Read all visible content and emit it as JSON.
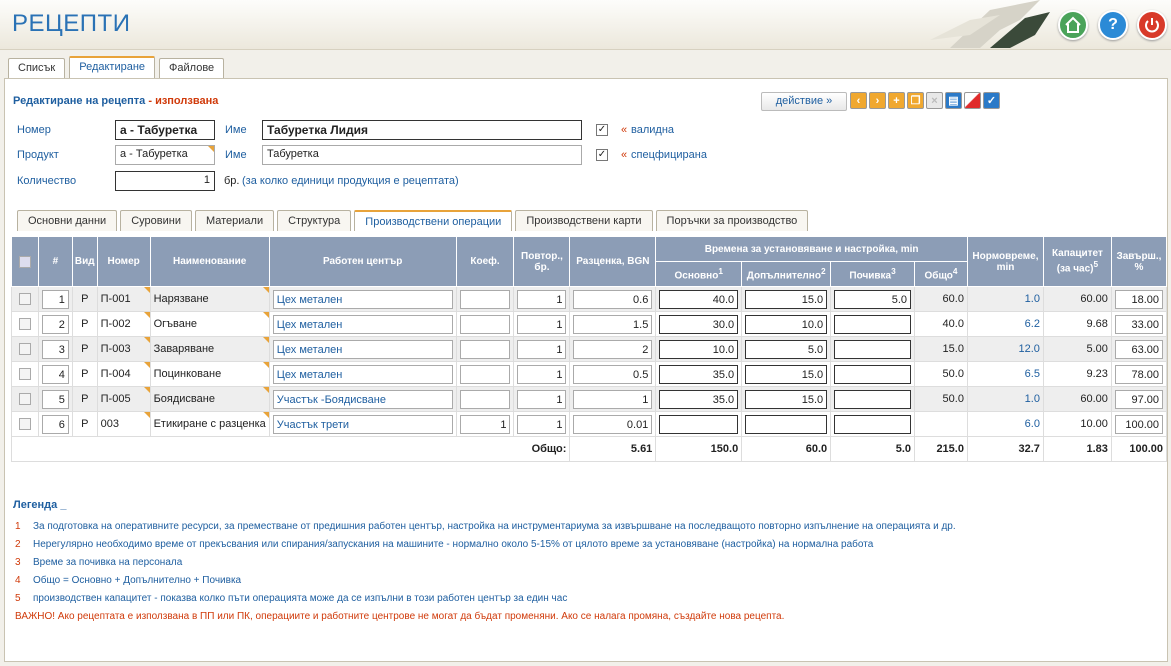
{
  "app": {
    "title": "РЕЦЕПТИ"
  },
  "header_buttons": {
    "home": "home-icon",
    "help": "?",
    "power": "power-icon"
  },
  "top_tabs": [
    "Списък",
    "Редактиране",
    "Файлове"
  ],
  "edit": {
    "title": "Редактиране на рецепта",
    "sep": " - ",
    "status": "използвана",
    "action_label": "действие  »"
  },
  "form": {
    "number_label": "Номер",
    "number_value": "а - Табуретка",
    "name_label": "Име",
    "name_value": "Табуретка Лидия",
    "valid_label": "« валидна",
    "product_label": "Продукт",
    "product_value": "а - Табуретка",
    "product_name_label": "Име",
    "product_name_value": "Табуретка",
    "specified_label": "« спецфицирана",
    "qty_label": "Количество",
    "qty_value": "1",
    "qty_unit": "бр.",
    "qty_hint": "(за колко единици продукция е рецептата)"
  },
  "sub_tabs": [
    "Основни данни",
    "Суровини",
    "Материали",
    "Структура",
    "Производствени операции",
    "Производствени карти",
    "Поръчки за производство"
  ],
  "table": {
    "headers": {
      "num": "#",
      "kind": "Вид",
      "code": "Номер",
      "name": "Наименование",
      "wc": "Работен център",
      "coef": "Коеф.",
      "rep": "Повтор., бр.",
      "cost": "Разценка, BGN",
      "times": "Времена за установяване и настройка, min",
      "base": "Основно",
      "extra": "Допълнително",
      "rest": "Почивка",
      "total": "Общо",
      "norm": "Нормовреме, min",
      "cap": "Капацитет (за час)",
      "done": "Завърш., %"
    },
    "rows": [
      {
        "n": "1",
        "kind": "Р",
        "code": "П-001",
        "name": "Нарязване",
        "wc": "Цех метален",
        "coef": "",
        "rep": "1",
        "cost": "0.6",
        "base": "40.0",
        "extra": "15.0",
        "rest": "5.0",
        "total": "60.0",
        "norm": "1.0",
        "cap": "60.00",
        "done": "18.00"
      },
      {
        "n": "2",
        "kind": "Р",
        "code": "П-002",
        "name": "Огъване",
        "wc": "Цех метален",
        "coef": "",
        "rep": "1",
        "cost": "1.5",
        "base": "30.0",
        "extra": "10.0",
        "rest": "",
        "total": "40.0",
        "norm": "6.2",
        "cap": "9.68",
        "done": "33.00"
      },
      {
        "n": "3",
        "kind": "Р",
        "code": "П-003",
        "name": "Заваряване",
        "wc": "Цех метален",
        "coef": "",
        "rep": "1",
        "cost": "2",
        "base": "10.0",
        "extra": "5.0",
        "rest": "",
        "total": "15.0",
        "norm": "12.0",
        "cap": "5.00",
        "done": "63.00"
      },
      {
        "n": "4",
        "kind": "Р",
        "code": "П-004",
        "name": "Поцинковане",
        "wc": "Цех метален",
        "coef": "",
        "rep": "1",
        "cost": "0.5",
        "base": "35.0",
        "extra": "15.0",
        "rest": "",
        "total": "50.0",
        "norm": "6.5",
        "cap": "9.23",
        "done": "78.00"
      },
      {
        "n": "5",
        "kind": "Р",
        "code": "П-005",
        "name": "Боядисване",
        "wc": "Участък -Боядисване",
        "coef": "",
        "rep": "1",
        "cost": "1",
        "base": "35.0",
        "extra": "15.0",
        "rest": "",
        "total": "50.0",
        "norm": "1.0",
        "cap": "60.00",
        "done": "97.00"
      },
      {
        "n": "6",
        "kind": "Р",
        "code": "003",
        "name": "Етикиране с разценка",
        "wc": "Участък трети",
        "coef": "1",
        "rep": "1",
        "cost": "0.01",
        "base": "",
        "extra": "",
        "rest": "",
        "total": "",
        "norm": "6.0",
        "cap": "10.00",
        "done": "100.00"
      }
    ],
    "totals": {
      "label": "Общо:",
      "cost": "5.61",
      "base": "150.0",
      "extra": "60.0",
      "rest": "5.0",
      "total": "215.0",
      "norm": "32.7",
      "cap": "1.83",
      "done": "100.00"
    }
  },
  "legend": {
    "title": "Легенда _",
    "items": [
      {
        "n": "1",
        "text": "За подготовка на оперативните ресурси, за преместване от предишния работен център, настройка на инструментариума за извършване на последващото повторно изпълнение на операцията и др."
      },
      {
        "n": "2",
        "text": "Нерегулярно необходимо време от прекъсвания или спирания/запускания на машините - нормално около 5-15% от цялото време за установяване (настройка) на нормална работа"
      },
      {
        "n": "3",
        "text": "Време за почивка на персонала"
      },
      {
        "n": "4",
        "text": "Общо = Основно + Допълнително + Почивка"
      },
      {
        "n": "5",
        "text": "производствен капацитет - показва колко пъти операцията може да се изпълни в този работен център за един час"
      }
    ],
    "warning_prefix": "ВАЖНО!",
    "warning": " Ако рецептата е използвана в ПП или ПК, операциите и работните центрове не могат да бъдат променяни. Ако се налага промяна, създайте нова рецепта."
  }
}
